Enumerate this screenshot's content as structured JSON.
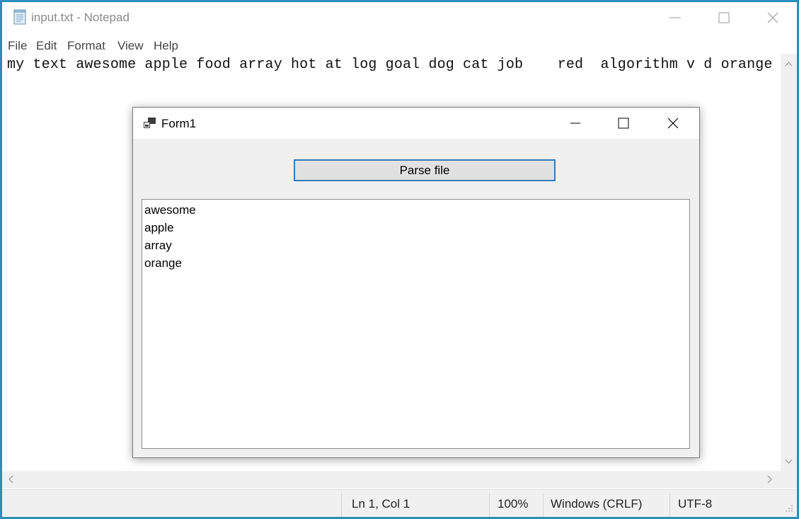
{
  "notepad": {
    "title": "input.txt - Notepad",
    "menu": [
      "File",
      "Edit",
      "Format",
      "View",
      "Help"
    ],
    "content": "my text awesome apple food array hot at log goal dog cat job    red  algorithm v d orange",
    "status": {
      "position": "Ln 1, Col 1",
      "zoom": "100%",
      "line_ending": "Windows (CRLF)",
      "encoding": "UTF-8"
    }
  },
  "form1": {
    "title": "Form1",
    "parse_button": "Parse file",
    "results": [
      "awesome",
      "apple",
      "array",
      "orange"
    ]
  },
  "icons": {
    "notepad_app": "notepad-icon",
    "form_app": "form-window-icon",
    "minimize": "minimize-icon",
    "maximize": "maximize-icon",
    "close": "close-icon",
    "resize_grip": "resize-grip-icon"
  }
}
